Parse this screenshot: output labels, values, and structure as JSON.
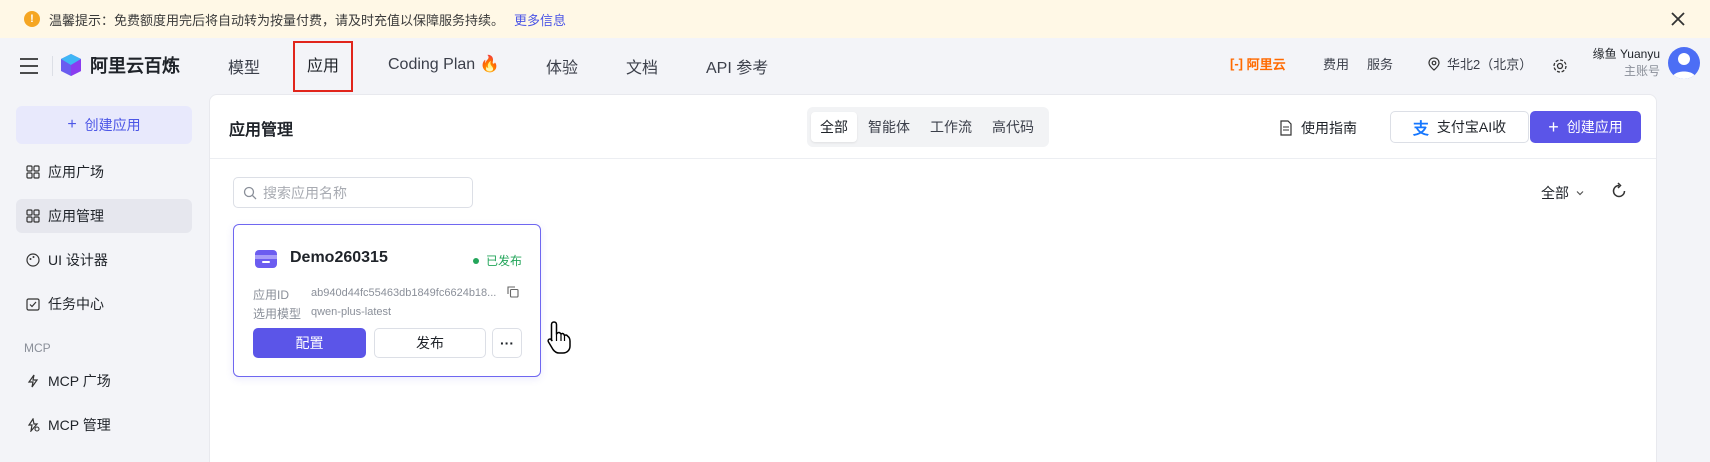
{
  "notice": {
    "text": "温馨提示：免费额度用完后将自动转为按量付费，请及时充值以保障服务持续。",
    "more_link": "更多信息"
  },
  "brand": {
    "name": "阿里云百炼"
  },
  "topnav": {
    "items": [
      {
        "label": "模型"
      },
      {
        "label": "应用"
      },
      {
        "label": "Coding Plan"
      },
      {
        "label": "体验"
      },
      {
        "label": "文档"
      },
      {
        "label": "API 参考"
      }
    ]
  },
  "rightbar": {
    "aliyun_label": "阿里云",
    "billing": "费用",
    "service": "服务",
    "region": "华北2（北京）",
    "user_name": "缘鱼 Yuanyu",
    "user_role": "主账号"
  },
  "sidebar": {
    "create_label": "创建应用",
    "items": [
      {
        "label": "应用广场"
      },
      {
        "label": "应用管理"
      },
      {
        "label": "UI 设计器"
      },
      {
        "label": "任务中心"
      }
    ],
    "section_mcp": "MCP",
    "mcp_items": [
      {
        "label": "MCP 广场"
      },
      {
        "label": "MCP 管理"
      }
    ]
  },
  "main": {
    "title": "应用管理",
    "filters": [
      "全部",
      "智能体",
      "工作流",
      "高代码"
    ],
    "guide_label": "使用指南",
    "alipay_label": "支付宝AI收",
    "create_label": "创建应用",
    "search_placeholder": "搜索应用名称",
    "scope_filter": "全部"
  },
  "card": {
    "name": "Demo260315",
    "status": "已发布",
    "app_id_label": "应用ID",
    "app_id_value": "ab940d44fc55463db1849fc6624b18...",
    "model_label": "选用模型",
    "model_value": "qwen-plus-latest",
    "config_label": "配置",
    "publish_label": "发布"
  },
  "colors": {
    "accent": "#5b55e8",
    "success": "#23a55a",
    "highlight_box": "#e1251b",
    "brand_orange": "#ff6a00"
  }
}
